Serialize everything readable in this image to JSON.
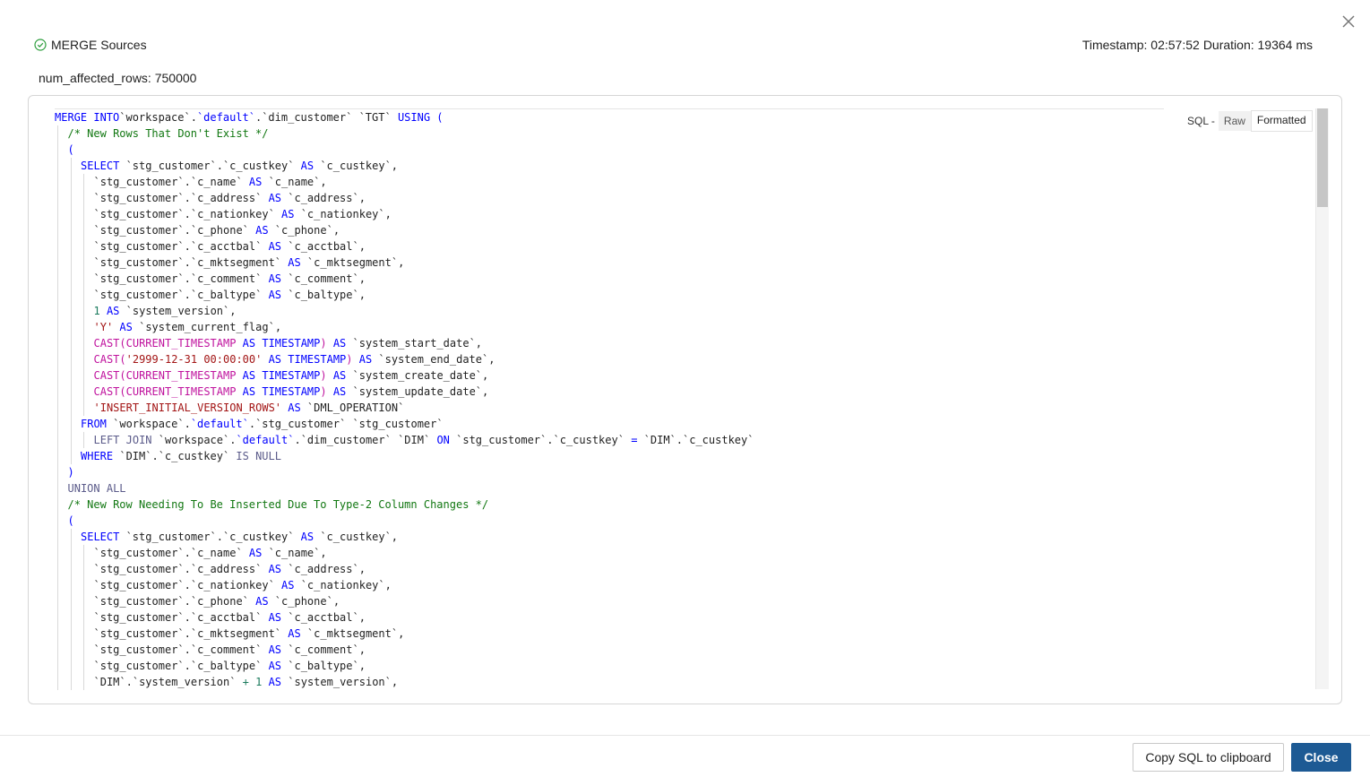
{
  "header": {
    "status_label": "MERGE Sources",
    "timestamp": "Timestamp: 02:57:52",
    "duration": "Duration: 19364 ms",
    "affected_rows": "num_affected_rows: 750000"
  },
  "sql_view": {
    "label": "SQL -",
    "options": [
      "Raw",
      "Formatted"
    ],
    "selected": "Formatted"
  },
  "code_lines": [
    {
      "indent": 0,
      "t": [
        [
          "kw",
          "MERGE INTO"
        ],
        [
          "",
          "`workspace`."
        ],
        [
          "kw",
          "`default`"
        ],
        [
          "",
          ".`dim_customer` `TGT` "
        ],
        [
          "kw",
          "USING ("
        ]
      ]
    },
    {
      "indent": 1,
      "t": [
        [
          "cm",
          "/* New Rows That Don't Exist */"
        ]
      ]
    },
    {
      "indent": 1,
      "t": [
        [
          "kw",
          "("
        ]
      ]
    },
    {
      "indent": 2,
      "t": [
        [
          "kw",
          "SELECT"
        ],
        [
          "",
          " `stg_customer`.`c_custkey` "
        ],
        [
          "kw",
          "AS"
        ],
        [
          "",
          " `c_custkey`,"
        ]
      ]
    },
    {
      "indent": 3,
      "t": [
        [
          "",
          "`stg_customer`.`c_name` "
        ],
        [
          "kw",
          "AS"
        ],
        [
          "",
          " `c_name`,"
        ]
      ]
    },
    {
      "indent": 3,
      "t": [
        [
          "",
          "`stg_customer`.`c_address` "
        ],
        [
          "kw",
          "AS"
        ],
        [
          "",
          " `c_address`,"
        ]
      ]
    },
    {
      "indent": 3,
      "t": [
        [
          "",
          "`stg_customer`.`c_nationkey` "
        ],
        [
          "kw",
          "AS"
        ],
        [
          "",
          " `c_nationkey`,"
        ]
      ]
    },
    {
      "indent": 3,
      "t": [
        [
          "",
          "`stg_customer`.`c_phone` "
        ],
        [
          "kw",
          "AS"
        ],
        [
          "",
          " `c_phone`,"
        ]
      ]
    },
    {
      "indent": 3,
      "t": [
        [
          "",
          "`stg_customer`.`c_acctbal` "
        ],
        [
          "kw",
          "AS"
        ],
        [
          "",
          " `c_acctbal`,"
        ]
      ]
    },
    {
      "indent": 3,
      "t": [
        [
          "",
          "`stg_customer`.`c_mktsegment` "
        ],
        [
          "kw",
          "AS"
        ],
        [
          "",
          " `c_mktsegment`,"
        ]
      ]
    },
    {
      "indent": 3,
      "t": [
        [
          "",
          "`stg_customer`.`c_comment` "
        ],
        [
          "kw",
          "AS"
        ],
        [
          "",
          " `c_comment`,"
        ]
      ]
    },
    {
      "indent": 3,
      "t": [
        [
          "",
          "`stg_customer`.`c_baltype` "
        ],
        [
          "kw",
          "AS"
        ],
        [
          "",
          " `c_baltype`,"
        ]
      ]
    },
    {
      "indent": 3,
      "t": [
        [
          "num",
          "1"
        ],
        [
          "kw",
          " AS"
        ],
        [
          "",
          " `system_version`,"
        ]
      ]
    },
    {
      "indent": 3,
      "t": [
        [
          "str",
          "'Y'"
        ],
        [
          "kw",
          " AS"
        ],
        [
          "",
          " `system_current_flag`,"
        ]
      ]
    },
    {
      "indent": 3,
      "t": [
        [
          "fn",
          "CAST(CURRENT_TIMESTAMP"
        ],
        [
          "kw",
          " AS TIMESTAMP"
        ],
        [
          "fn",
          ")"
        ],
        [
          "kw",
          " AS"
        ],
        [
          "",
          " `system_start_date`,"
        ]
      ]
    },
    {
      "indent": 3,
      "t": [
        [
          "fn",
          "CAST("
        ],
        [
          "str",
          "'2999-12-31 00:00:00'"
        ],
        [
          "kw",
          " AS TIMESTAMP"
        ],
        [
          "fn",
          ")"
        ],
        [
          "kw",
          " AS"
        ],
        [
          "",
          " `system_end_date`,"
        ]
      ]
    },
    {
      "indent": 3,
      "t": [
        [
          "fn",
          "CAST(CURRENT_TIMESTAMP"
        ],
        [
          "kw",
          " AS TIMESTAMP"
        ],
        [
          "fn",
          ")"
        ],
        [
          "kw",
          " AS"
        ],
        [
          "",
          " `system_create_date`,"
        ]
      ]
    },
    {
      "indent": 3,
      "t": [
        [
          "fn",
          "CAST(CURRENT_TIMESTAMP"
        ],
        [
          "kw",
          " AS TIMESTAMP"
        ],
        [
          "fn",
          ")"
        ],
        [
          "kw",
          " AS"
        ],
        [
          "",
          " `system_update_date`,"
        ]
      ]
    },
    {
      "indent": 3,
      "t": [
        [
          "str",
          "'INSERT_INITIAL_VERSION_ROWS'"
        ],
        [
          "kw",
          " AS"
        ],
        [
          "",
          " `DML_OPERATION`"
        ]
      ]
    },
    {
      "indent": 2,
      "t": [
        [
          "kw",
          "FROM"
        ],
        [
          "",
          " `workspace`."
        ],
        [
          "kw",
          "`default`"
        ],
        [
          "",
          ".`stg_customer` `stg_customer`"
        ]
      ]
    },
    {
      "indent": 3,
      "t": [
        [
          "kw2",
          "LEFT JOIN"
        ],
        [
          "",
          " `workspace`."
        ],
        [
          "kw",
          "`default`"
        ],
        [
          "",
          ".`dim_customer` `DIM` "
        ],
        [
          "kw",
          "ON"
        ],
        [
          "",
          " `stg_customer`.`c_custkey` "
        ],
        [
          "kw",
          "="
        ],
        [
          "",
          " `DIM`.`c_custkey`"
        ]
      ]
    },
    {
      "indent": 2,
      "t": [
        [
          "kw",
          "WHERE"
        ],
        [
          "",
          " `DIM`.`c_custkey` "
        ],
        [
          "kw2",
          "IS NULL"
        ]
      ]
    },
    {
      "indent": 1,
      "t": [
        [
          "kw",
          ")"
        ]
      ]
    },
    {
      "indent": 1,
      "t": [
        [
          "kw2",
          "UNION ALL"
        ]
      ]
    },
    {
      "indent": 1,
      "t": [
        [
          "cm",
          "/* New Row Needing To Be Inserted Due To Type-2 Column Changes */"
        ]
      ]
    },
    {
      "indent": 1,
      "t": [
        [
          "kw",
          "("
        ]
      ]
    },
    {
      "indent": 2,
      "t": [
        [
          "kw",
          "SELECT"
        ],
        [
          "",
          " `stg_customer`.`c_custkey` "
        ],
        [
          "kw",
          "AS"
        ],
        [
          "",
          " `c_custkey`,"
        ]
      ]
    },
    {
      "indent": 3,
      "t": [
        [
          "",
          "`stg_customer`.`c_name` "
        ],
        [
          "kw",
          "AS"
        ],
        [
          "",
          " `c_name`,"
        ]
      ]
    },
    {
      "indent": 3,
      "t": [
        [
          "",
          "`stg_customer`.`c_address` "
        ],
        [
          "kw",
          "AS"
        ],
        [
          "",
          " `c_address`,"
        ]
      ]
    },
    {
      "indent": 3,
      "t": [
        [
          "",
          "`stg_customer`.`c_nationkey` "
        ],
        [
          "kw",
          "AS"
        ],
        [
          "",
          " `c_nationkey`,"
        ]
      ]
    },
    {
      "indent": 3,
      "t": [
        [
          "",
          "`stg_customer`.`c_phone` "
        ],
        [
          "kw",
          "AS"
        ],
        [
          "",
          " `c_phone`,"
        ]
      ]
    },
    {
      "indent": 3,
      "t": [
        [
          "",
          "`stg_customer`.`c_acctbal` "
        ],
        [
          "kw",
          "AS"
        ],
        [
          "",
          " `c_acctbal`,"
        ]
      ]
    },
    {
      "indent": 3,
      "t": [
        [
          "",
          "`stg_customer`.`c_mktsegment` "
        ],
        [
          "kw",
          "AS"
        ],
        [
          "",
          " `c_mktsegment`,"
        ]
      ]
    },
    {
      "indent": 3,
      "t": [
        [
          "",
          "`stg_customer`.`c_comment` "
        ],
        [
          "kw",
          "AS"
        ],
        [
          "",
          " `c_comment`,"
        ]
      ]
    },
    {
      "indent": 3,
      "t": [
        [
          "",
          "`stg_customer`.`c_baltype` "
        ],
        [
          "kw",
          "AS"
        ],
        [
          "",
          " `c_baltype`,"
        ]
      ]
    },
    {
      "indent": 3,
      "t": [
        [
          "",
          "`DIM`.`system_version` "
        ],
        [
          "num",
          "+ 1"
        ],
        [
          "kw",
          " AS"
        ],
        [
          "",
          " `system_version`,"
        ]
      ]
    }
  ],
  "footer": {
    "copy_label": "Copy SQL to clipboard",
    "close_label": "Close"
  },
  "colors": {
    "keyword": "#0000ff",
    "function": "#c0139e",
    "comment": "#117711",
    "string": "#a31515",
    "primary_button": "#1d5a94",
    "success": "#2e9e3e"
  },
  "icons": [
    "close-icon",
    "check-circle-icon"
  ]
}
